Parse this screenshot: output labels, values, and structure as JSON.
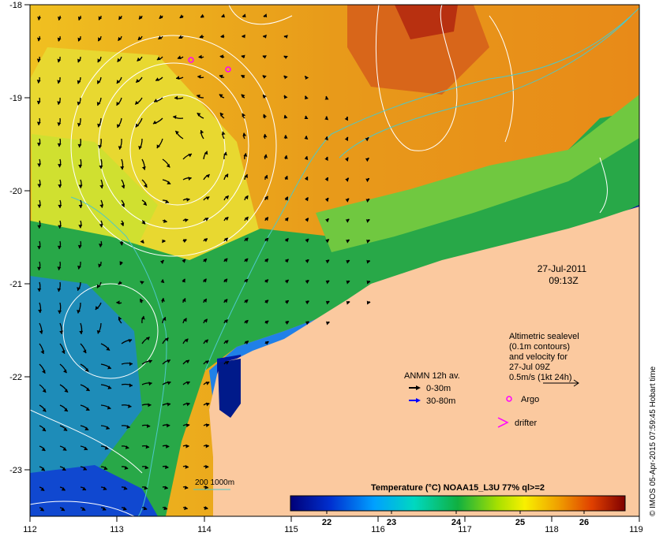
{
  "map": {
    "lon_ticks": [
      "112",
      "113",
      "114",
      "115",
      "116",
      "117",
      "118",
      "119"
    ],
    "lat_ticks": [
      "-18",
      "-19",
      "-20",
      "-21",
      "-22",
      "-23"
    ],
    "date": "27-Jul-2011",
    "time": "09:13Z",
    "altimetry_note": [
      "Altimetric sealevel",
      "(0.1m contours)",
      "and velocity for",
      "27-Jul 09Z"
    ],
    "velocity_scale": "0.5m/s (1kt 24h)",
    "anmn_title": "ANMN 12h av.",
    "anmn_shallow": "0-30m",
    "anmn_deep": "30-80m",
    "argo_label": "Argo",
    "drifter_label": "drifter",
    "isobath_label": "200  1000m",
    "colorbar_title": "Temperature (°C) NOAA15_L3U 77% ql>=2",
    "colorbar_ticks": [
      "22",
      "23",
      "24",
      "25",
      "26"
    ],
    "credit": "© IMOS 05-Apr-2015 07:59:45 Hobart time",
    "colors": {
      "land": "#fbc99f",
      "isobath": "#4dc8c8",
      "argo": "#ff00ff",
      "anmn_shallow": "#000000",
      "anmn_deep": "#0000ff"
    }
  }
}
